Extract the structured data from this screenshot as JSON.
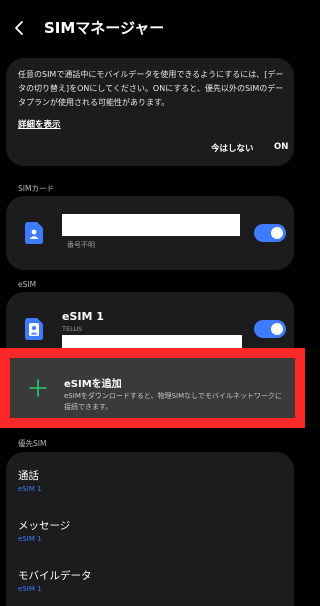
{
  "header": {
    "title": "SIMマネージャー"
  },
  "info": {
    "text": "任意のSIMで通話中にモバイルデータを使用できるようにするには、[データの切り替え]をONにしてください。ONにすると、優先以外のSIMのデータプランが使用される可能性があります。",
    "link": "詳細を表示",
    "later_label": "今はしない",
    "on_label": "ON"
  },
  "sim_section": {
    "label": "SIMカード",
    "number_text": "番号不明",
    "enabled": true
  },
  "esim_section": {
    "label": "eSIM",
    "name": "eSIM 1",
    "carrier": "TELUS",
    "enabled": true
  },
  "add_esim": {
    "title": "eSIMを追加",
    "description": "eSIMをダウンロードすると、物理SIMなしでモバイルネットワークに接続できます。"
  },
  "priority": {
    "label": "優先SIM",
    "items": [
      {
        "title": "通話",
        "value": "eSIM 1"
      },
      {
        "title": "メッセージ",
        "value": "eSIM 1"
      },
      {
        "title": "モバイルデータ",
        "value": "eSIM 1"
      }
    ]
  },
  "colors": {
    "accent": "#3e7bff",
    "highlight": "#ff2828",
    "card": "#1c1c1e"
  }
}
